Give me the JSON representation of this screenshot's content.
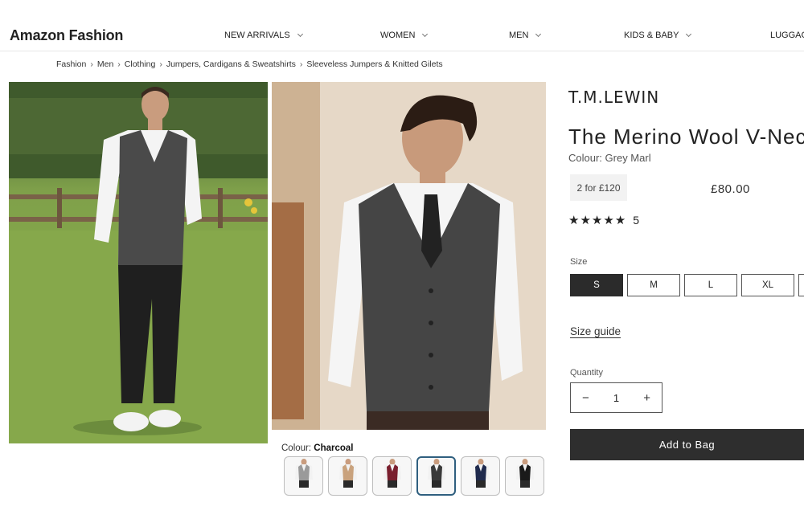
{
  "header": {
    "logo": "Amazon Fashion",
    "nav": [
      {
        "label": "NEW ARRIVALS"
      },
      {
        "label": "WOMEN"
      },
      {
        "label": "MEN"
      },
      {
        "label": "KIDS & BABY"
      },
      {
        "label": "LUGGAG"
      }
    ]
  },
  "breadcrumb": [
    "Fashion",
    "Men",
    "Clothing",
    "Jumpers, Cardigans & Sweatshirts",
    "Sleeveless Jumpers & Knitted Gilets"
  ],
  "breadcrumb_separator": "›",
  "gallery": {
    "colour_label": "Colour:",
    "selected_colour": "Charcoal",
    "swatch_colors": [
      "#9a9a9a",
      "#c9a27d",
      "#7a1f2e",
      "#3a3a3a",
      "#1f2a4d",
      "#1a1a1a"
    ],
    "selected_index": 3
  },
  "product": {
    "brand": "T.M.LEWIN",
    "title": "The Merino Wool V-Neck",
    "colour": "Colour: Grey Marl",
    "offer": "2 for £120",
    "price": "£80.00",
    "rating_stars": 5,
    "rating_count": "5",
    "size_label": "Size",
    "sizes": [
      "S",
      "M",
      "L",
      "XL"
    ],
    "selected_size": "S",
    "size_guide": "Size guide",
    "quantity_label": "Quantity",
    "quantity": "1",
    "minus": "−",
    "plus": "+",
    "add_to_bag": "Add to Bag"
  },
  "colors": {
    "primary_button": "#2e2e2e",
    "selected_swatch_border": "#2f5f7f"
  }
}
